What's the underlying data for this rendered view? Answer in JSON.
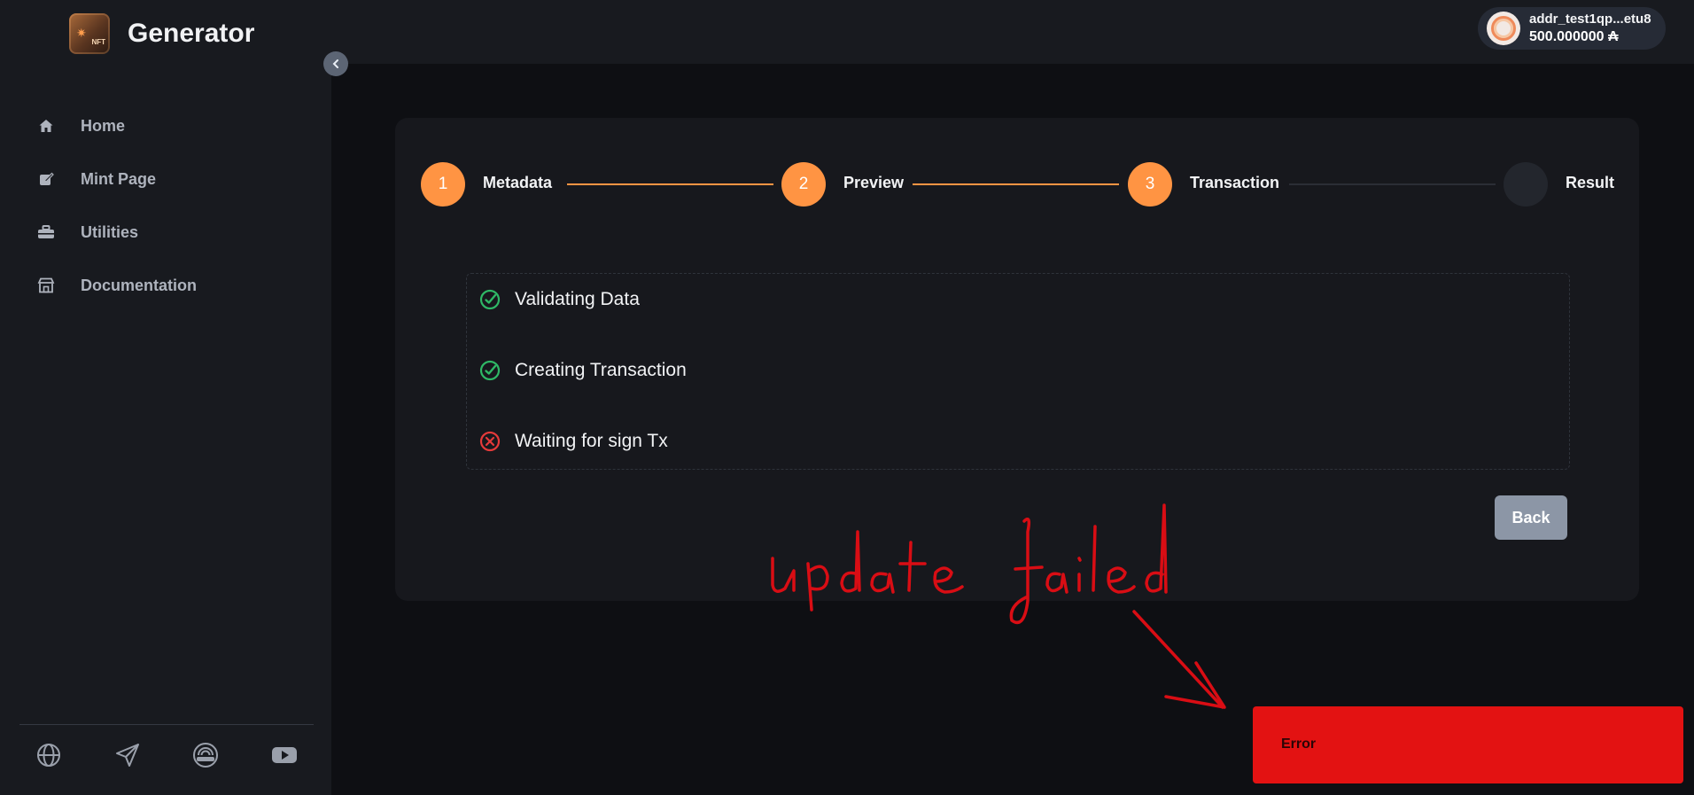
{
  "app": {
    "title": "Generator",
    "logo_text": "NFT"
  },
  "sidebar": {
    "items": [
      {
        "label": "Home",
        "icon": "home-icon"
      },
      {
        "label": "Mint Page",
        "icon": "mint-icon"
      },
      {
        "label": "Utilities",
        "icon": "toolbox-icon"
      },
      {
        "label": "Documentation",
        "icon": "store-icon"
      }
    ],
    "social": [
      "globe-icon",
      "send-icon",
      "signal-icon",
      "youtube-icon"
    ]
  },
  "wallet": {
    "address": "addr_test1qp...etu8",
    "balance": "500.000000 ₳"
  },
  "stepper": {
    "steps": [
      {
        "number": "1",
        "label": "Metadata",
        "status": "done"
      },
      {
        "number": "2",
        "label": "Preview",
        "status": "done"
      },
      {
        "number": "3",
        "label": "Transaction",
        "status": "active"
      },
      {
        "number": "",
        "label": "Result",
        "status": "pending"
      }
    ]
  },
  "transaction": {
    "items": [
      {
        "label": "Validating Data",
        "status": "success"
      },
      {
        "label": "Creating Transaction",
        "status": "success"
      },
      {
        "label": "Waiting for sign Tx",
        "status": "error"
      }
    ]
  },
  "actions": {
    "back_label": "Back"
  },
  "annotation": {
    "text": "update failed"
  },
  "toast": {
    "message": "Error"
  },
  "colors": {
    "accent": "#ff9443",
    "success": "#2fb866",
    "error": "#e53a3a",
    "toast_bg": "#e31212",
    "annotation": "#d90d14"
  }
}
